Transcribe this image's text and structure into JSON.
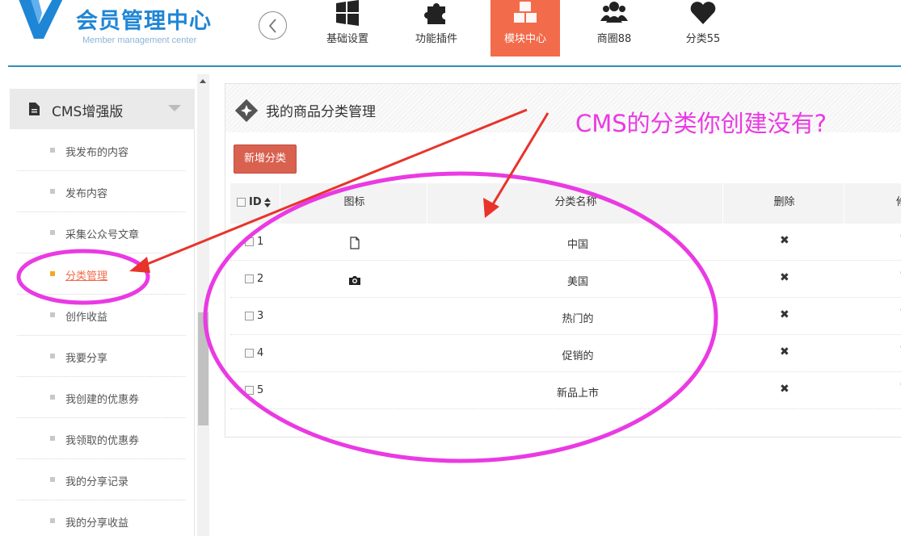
{
  "header": {
    "logo_title": "会员管理中心",
    "logo_subtitle": "Member management center",
    "back_icon": "chevron-left-circle-icon",
    "nav": [
      {
        "label": "基础设置",
        "icon": "windows-icon",
        "active": false
      },
      {
        "label": "功能插件",
        "icon": "puzzle-icon",
        "active": false
      },
      {
        "label": "模块中心",
        "icon": "cubes-icon",
        "active": true
      },
      {
        "label": "商圈88",
        "icon": "users-icon",
        "active": false
      },
      {
        "label": "分类55",
        "icon": "heart-icon",
        "active": false
      }
    ],
    "active_color": "#f26b4b",
    "divider_color": "#2f8fb8"
  },
  "sidebar": {
    "section_title": "CMS增强版",
    "section_icon": "document-icon",
    "items": [
      {
        "label": "我发布的内容"
      },
      {
        "label": "发布内容"
      },
      {
        "label": "采集公众号文章"
      },
      {
        "label": "分类管理",
        "active": true
      },
      {
        "label": "创作收益"
      },
      {
        "label": "我要分享"
      },
      {
        "label": "我创建的优惠券"
      },
      {
        "label": "我领取的优惠券"
      },
      {
        "label": "我的分享记录"
      },
      {
        "label": "我的分享收益"
      }
    ]
  },
  "main": {
    "title": "我的商品分类管理",
    "title_icon": "diamond-star-icon",
    "add_button": "新增分类",
    "add_button_color": "#d9614f",
    "table": {
      "columns": [
        "ID",
        "图标",
        "分类名称",
        "删除",
        "修"
      ],
      "rows": [
        {
          "id": "1",
          "icon": "file-icon",
          "name": "中国",
          "delete": "✖",
          "edit": "✎"
        },
        {
          "id": "2",
          "icon": "camera-icon",
          "name": "美国",
          "delete": "✖",
          "edit": "✎"
        },
        {
          "id": "3",
          "icon": "",
          "name": "热门的",
          "delete": "✖",
          "edit": "✎"
        },
        {
          "id": "4",
          "icon": "",
          "name": "促销的",
          "delete": "✖",
          "edit": "✎"
        },
        {
          "id": "5",
          "icon": "",
          "name": "新品上市",
          "delete": "✖",
          "edit": "✎"
        }
      ]
    }
  },
  "annotation": {
    "text": "CMS的分类你创建没有?",
    "color": "#ea3ae3",
    "arrow_color": "#e8332b"
  }
}
